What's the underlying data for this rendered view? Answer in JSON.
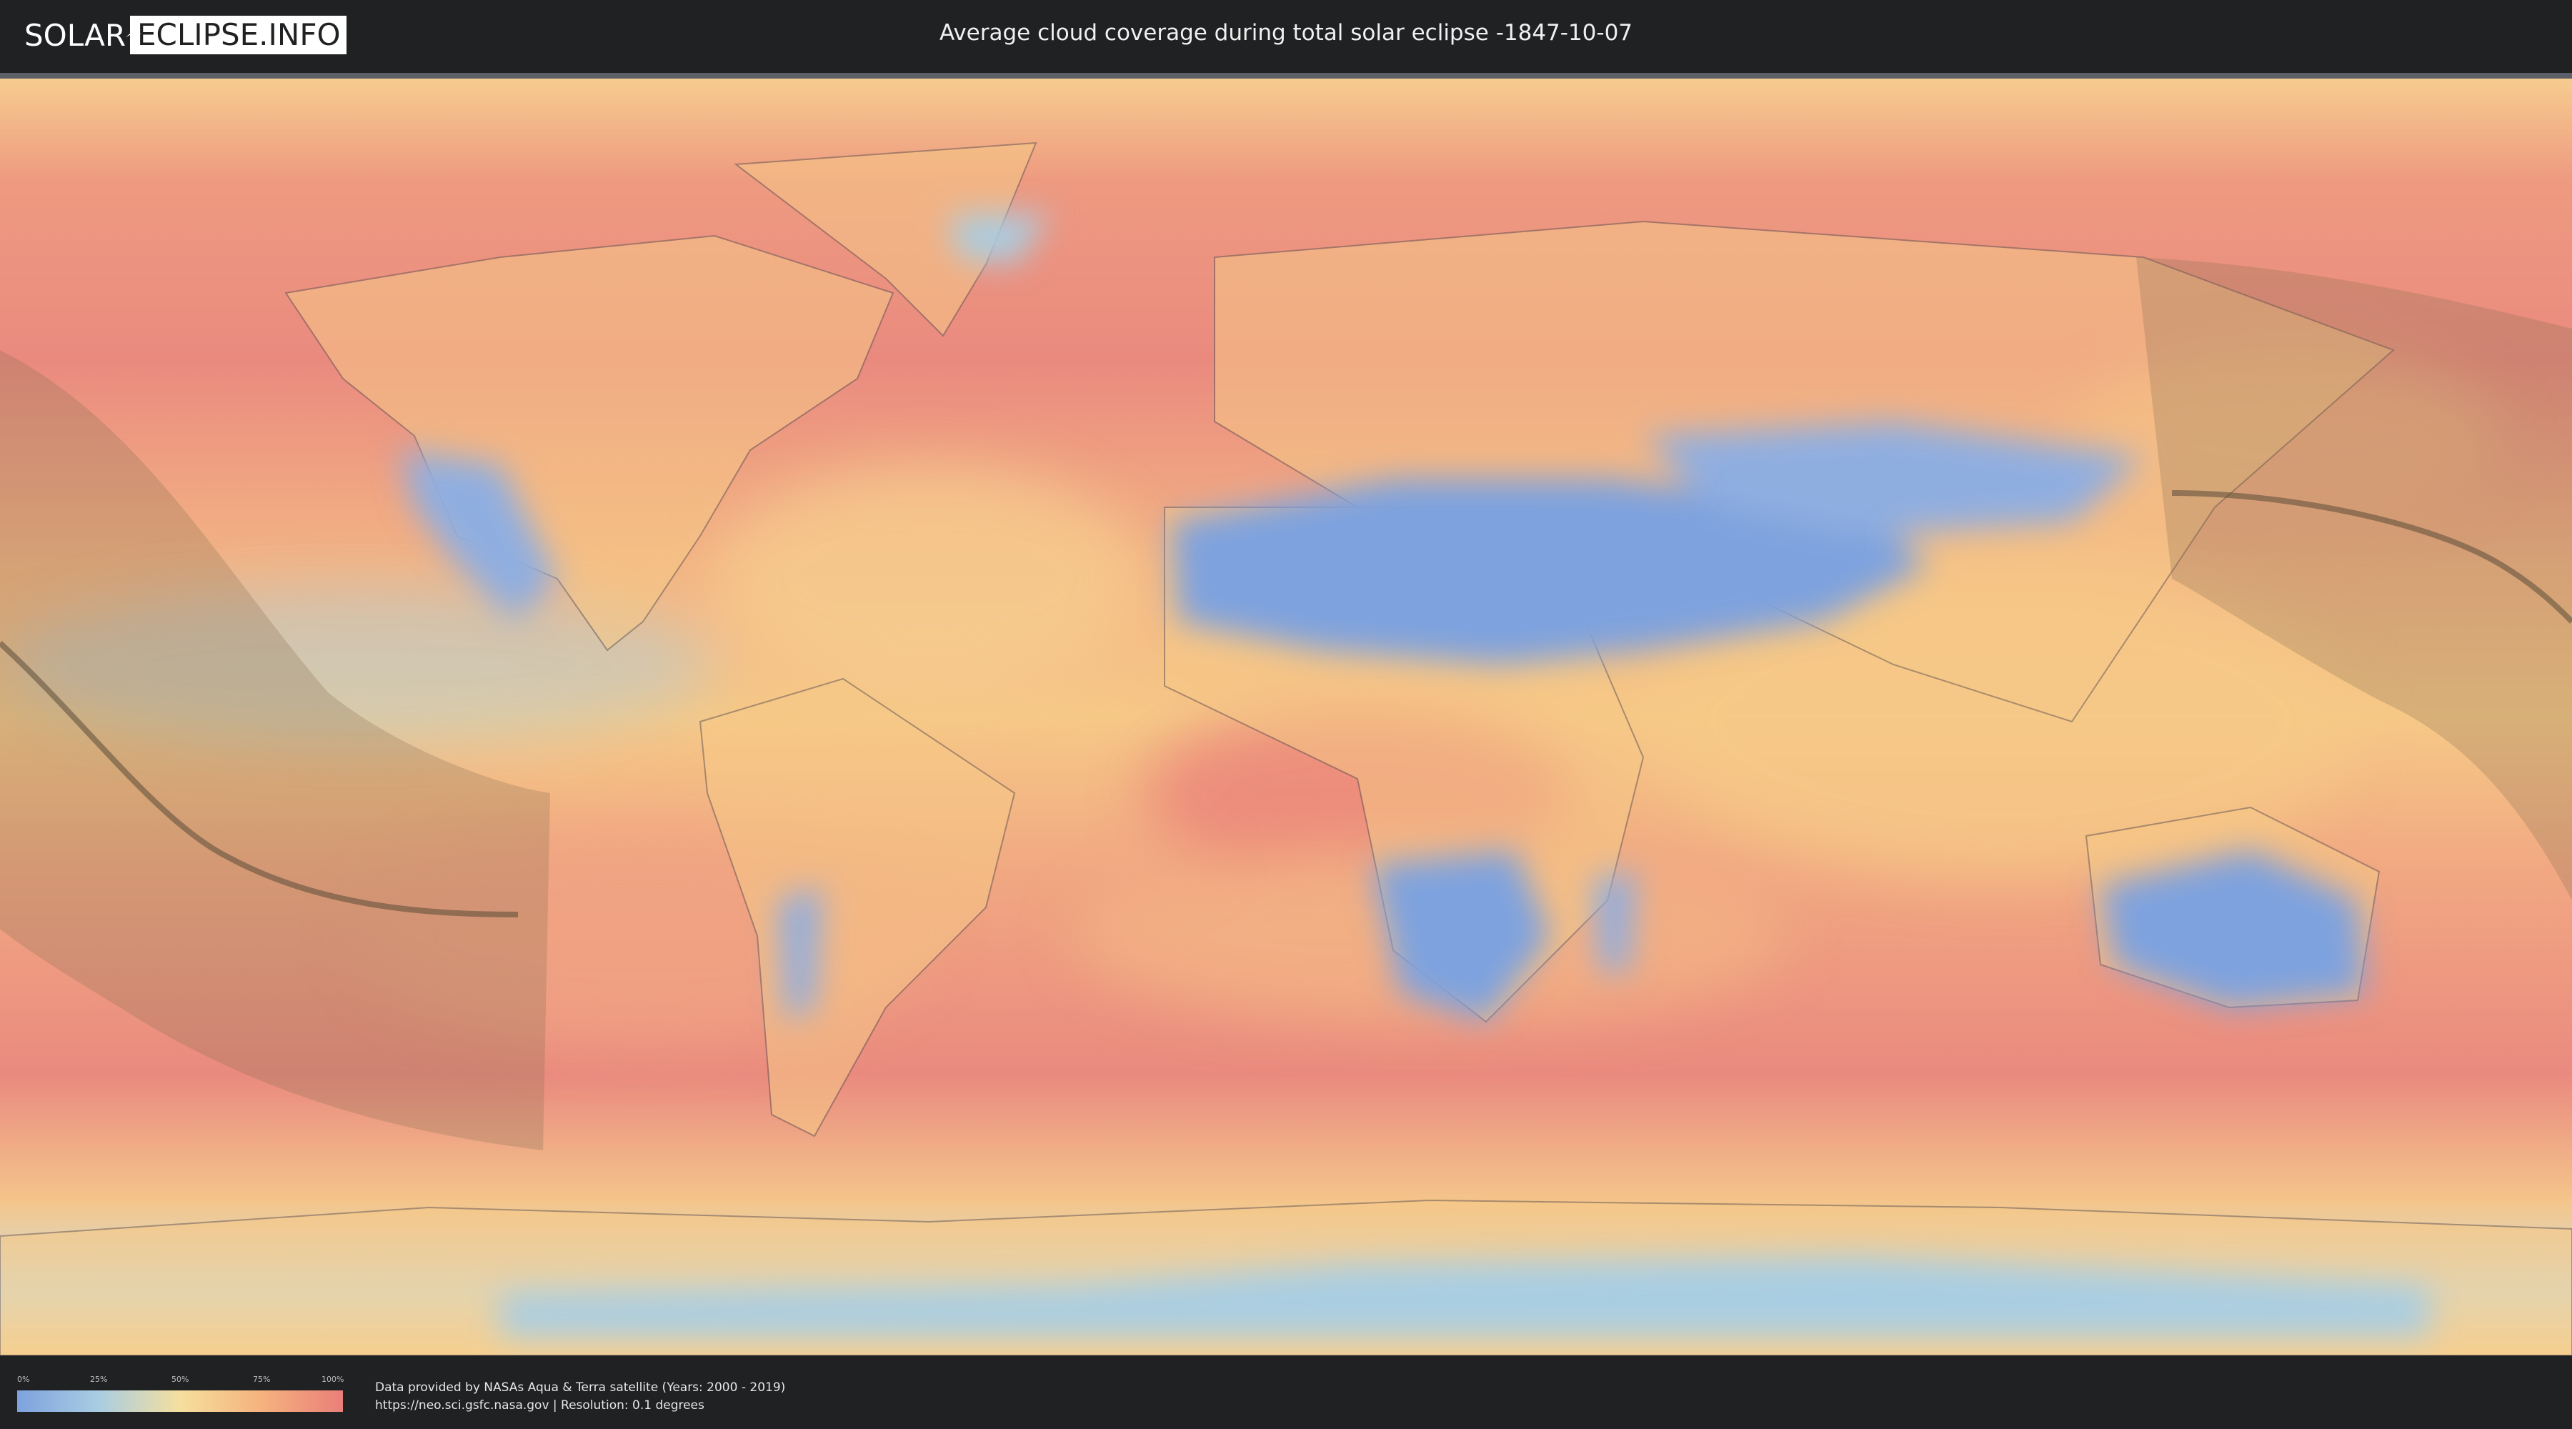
{
  "header": {
    "logo_left": "SOLAR",
    "logo_right": "ECLIPSE.INFO",
    "title": "Average cloud coverage during total solar eclipse -1847-10-07"
  },
  "map": {
    "colors": {
      "ocean_cloudy": "#ea8a7f",
      "mid_cloud": "#f3c48c",
      "clear": "#7ea2de",
      "partly": "#a9cde2",
      "eclipse_band": "#8a6f52",
      "centerline": "#5a4a38"
    }
  },
  "legend": {
    "ticks": [
      "0%",
      "25%",
      "50%",
      "75%",
      "100%"
    ],
    "colors": [
      "#7ea2de",
      "#a9cde2",
      "#f5df9e",
      "#f5b27e",
      "#ea7f79"
    ]
  },
  "footer": {
    "line1": "Data provided by NASAs Aqua & Terra satellite (Years: 2000 - 2019)",
    "line2": "https://neo.sci.gsfc.nasa.gov | Resolution: 0.1 degrees"
  }
}
